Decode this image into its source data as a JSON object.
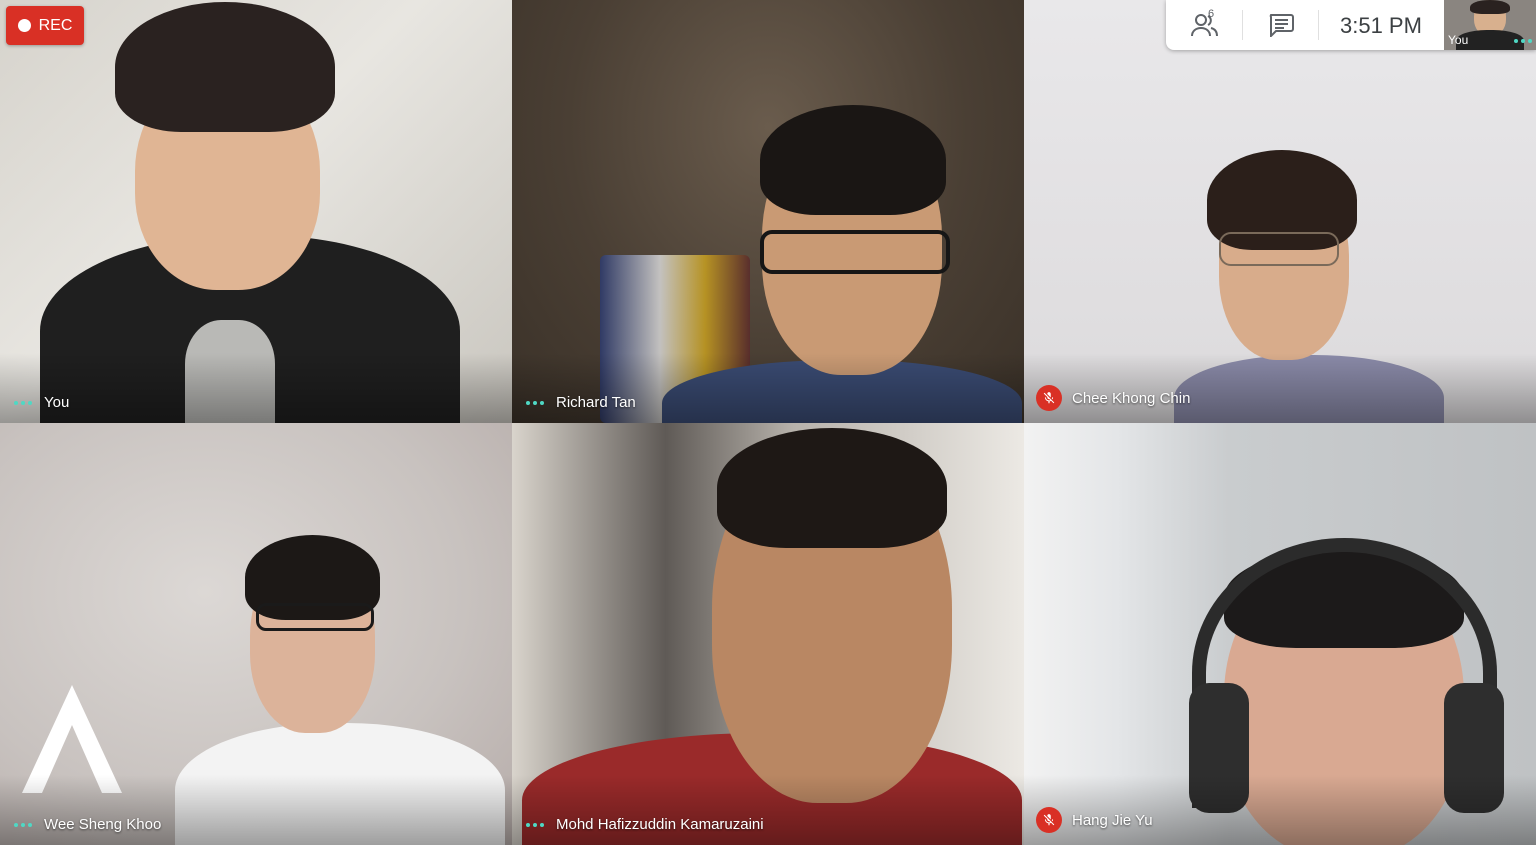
{
  "recording": {
    "label": "REC"
  },
  "topbar": {
    "participant_count": "6",
    "time": "3:51 PM",
    "self_label": "You"
  },
  "participants": [
    {
      "name": "You",
      "muted": false
    },
    {
      "name": "Richard Tan",
      "muted": false
    },
    {
      "name": "Chee Khong Chin",
      "muted": true
    },
    {
      "name": "Wee Sheng Khoo",
      "muted": false
    },
    {
      "name": "Mohd Hafizzuddin Kamaruzaini",
      "muted": false
    },
    {
      "name": "Hang Jie Yu",
      "muted": true
    }
  ],
  "icons": {
    "people": "people-icon",
    "chat": "chat-icon",
    "mic_off": "mic-off-icon",
    "more": "more-options-icon"
  },
  "colors": {
    "rec": "#d93025",
    "accent_dots": "#4fd8c4",
    "mute": "#d93025"
  }
}
